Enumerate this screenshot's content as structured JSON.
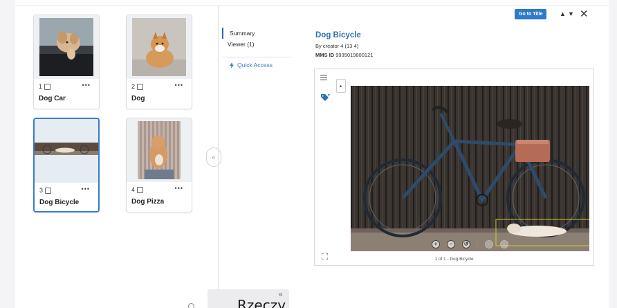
{
  "records": [
    {
      "number": "1",
      "title": "Dog Car",
      "more": "•••"
    },
    {
      "number": "2",
      "title": "Dog",
      "more": "•••"
    },
    {
      "number": "3",
      "title": "Dog Bicycle",
      "more": "•••"
    },
    {
      "number": "4",
      "title": "Dog Pizza",
      "more": "•••"
    }
  ],
  "collapse_glyph": "«",
  "nav": {
    "summary": "Summary",
    "viewer": "Viewer (1)",
    "quick_access": "Quick Access"
  },
  "header": {
    "goto_label": "Go to Title",
    "up_glyph": "▲",
    "down_glyph": "▼",
    "close_glyph": "✕"
  },
  "detail": {
    "title": "Dog Bicycle",
    "creator": "By creator 4 (13 4)",
    "mms_label": "MMS ID",
    "mms_value": "9935019800121"
  },
  "viewer": {
    "caption": "1 of 1 - Dog Bicycle",
    "zoom_in": "+",
    "zoom_out": "−",
    "reset": "↺"
  },
  "bottom": {
    "arrow": "«",
    "label": "Rzeczy"
  },
  "colors": {
    "accent": "#2d7ac9",
    "selected_border": "#3a7bc8",
    "link": "#2d6fb3"
  }
}
